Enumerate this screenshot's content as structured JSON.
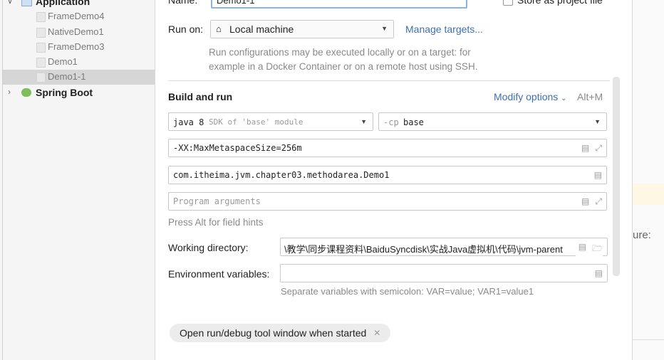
{
  "tree": {
    "root_label": "Application",
    "items": [
      "FrameDemo4",
      "NativeDemo1",
      "FrameDemo3",
      "Demo1",
      "Demo1-1"
    ],
    "spring_label": "Spring Boot"
  },
  "name": {
    "label": "Name:",
    "value": "Demo1-1"
  },
  "store": {
    "label": "Store as project file"
  },
  "run_on": {
    "label": "Run on:",
    "value": "Local machine",
    "manage": "Manage targets...",
    "desc1": "Run configurations may be executed locally or on a target: for",
    "desc2": "example in a Docker Container or on a remote host using SSH."
  },
  "build": {
    "title": "Build and run",
    "modify": "Modify options",
    "shortcut": "Alt+M",
    "sdk_bold": "java 8",
    "sdk_hint": "SDK of 'base' module",
    "cp_hint": "-cp",
    "cp_value": "base",
    "vm_options": "-XX:MaxMetaspaceSize=256m",
    "main_class": "com.itheima.jvm.chapter03.methodarea.Demo1",
    "args_placeholder": "Program arguments",
    "field_hint": "Press Alt for field hints"
  },
  "workdir": {
    "label": "Working directory:",
    "value": "\\教学\\同步课程资料\\BaiduSyncdisk\\实战Java虚拟机\\代码\\jvm-parent"
  },
  "env": {
    "label": "Environment variables:",
    "hint": "Separate variables with semicolon: VAR=value; VAR1=value1"
  },
  "chip": {
    "label": "Open run/debug tool window when started"
  },
  "side": {
    "text": "ure:"
  }
}
